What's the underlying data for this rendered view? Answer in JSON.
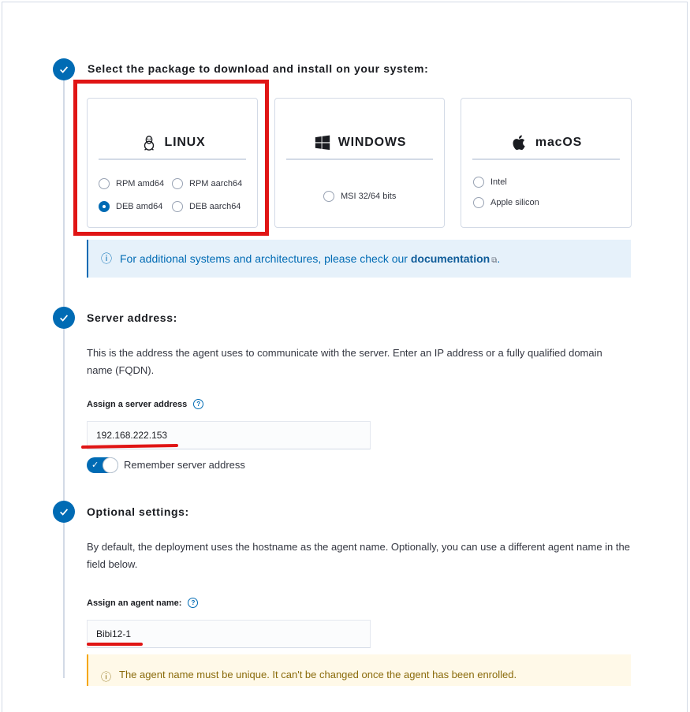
{
  "step1": {
    "title": "Select the package to download and install on your system:",
    "linux": {
      "label": "LINUX",
      "options": [
        "RPM amd64",
        "RPM aarch64",
        "DEB amd64",
        "DEB aarch64"
      ],
      "selected": "DEB amd64"
    },
    "windows": {
      "label": "WINDOWS",
      "options": [
        "MSI 32/64 bits"
      ]
    },
    "macos": {
      "label": "macOS",
      "options": [
        "Intel",
        "Apple silicon"
      ]
    },
    "info": {
      "prefix": "For additional systems and architectures, please check our",
      "link": "documentation",
      "suffix": "."
    }
  },
  "step2": {
    "title": "Server address:",
    "description": "This is the address the agent uses to communicate with the server. Enter an IP address or a fully qualified domain name (FQDN).",
    "field_label": "Assign a server address",
    "value": "192.168.222.153",
    "remember_label": "Remember server address",
    "remember_on": true
  },
  "step3": {
    "title": "Optional settings:",
    "description": "By default, the deployment uses the hostname as the agent name. Optionally, you can use a different agent name in the field below.",
    "field_label": "Assign an agent name:",
    "value": "Bibi12-1",
    "warning": "The agent name must be unique. It can't be changed once the agent has been enrolled."
  },
  "colors": {
    "accent": "#006bb4",
    "annotation_red": "#e01515"
  }
}
